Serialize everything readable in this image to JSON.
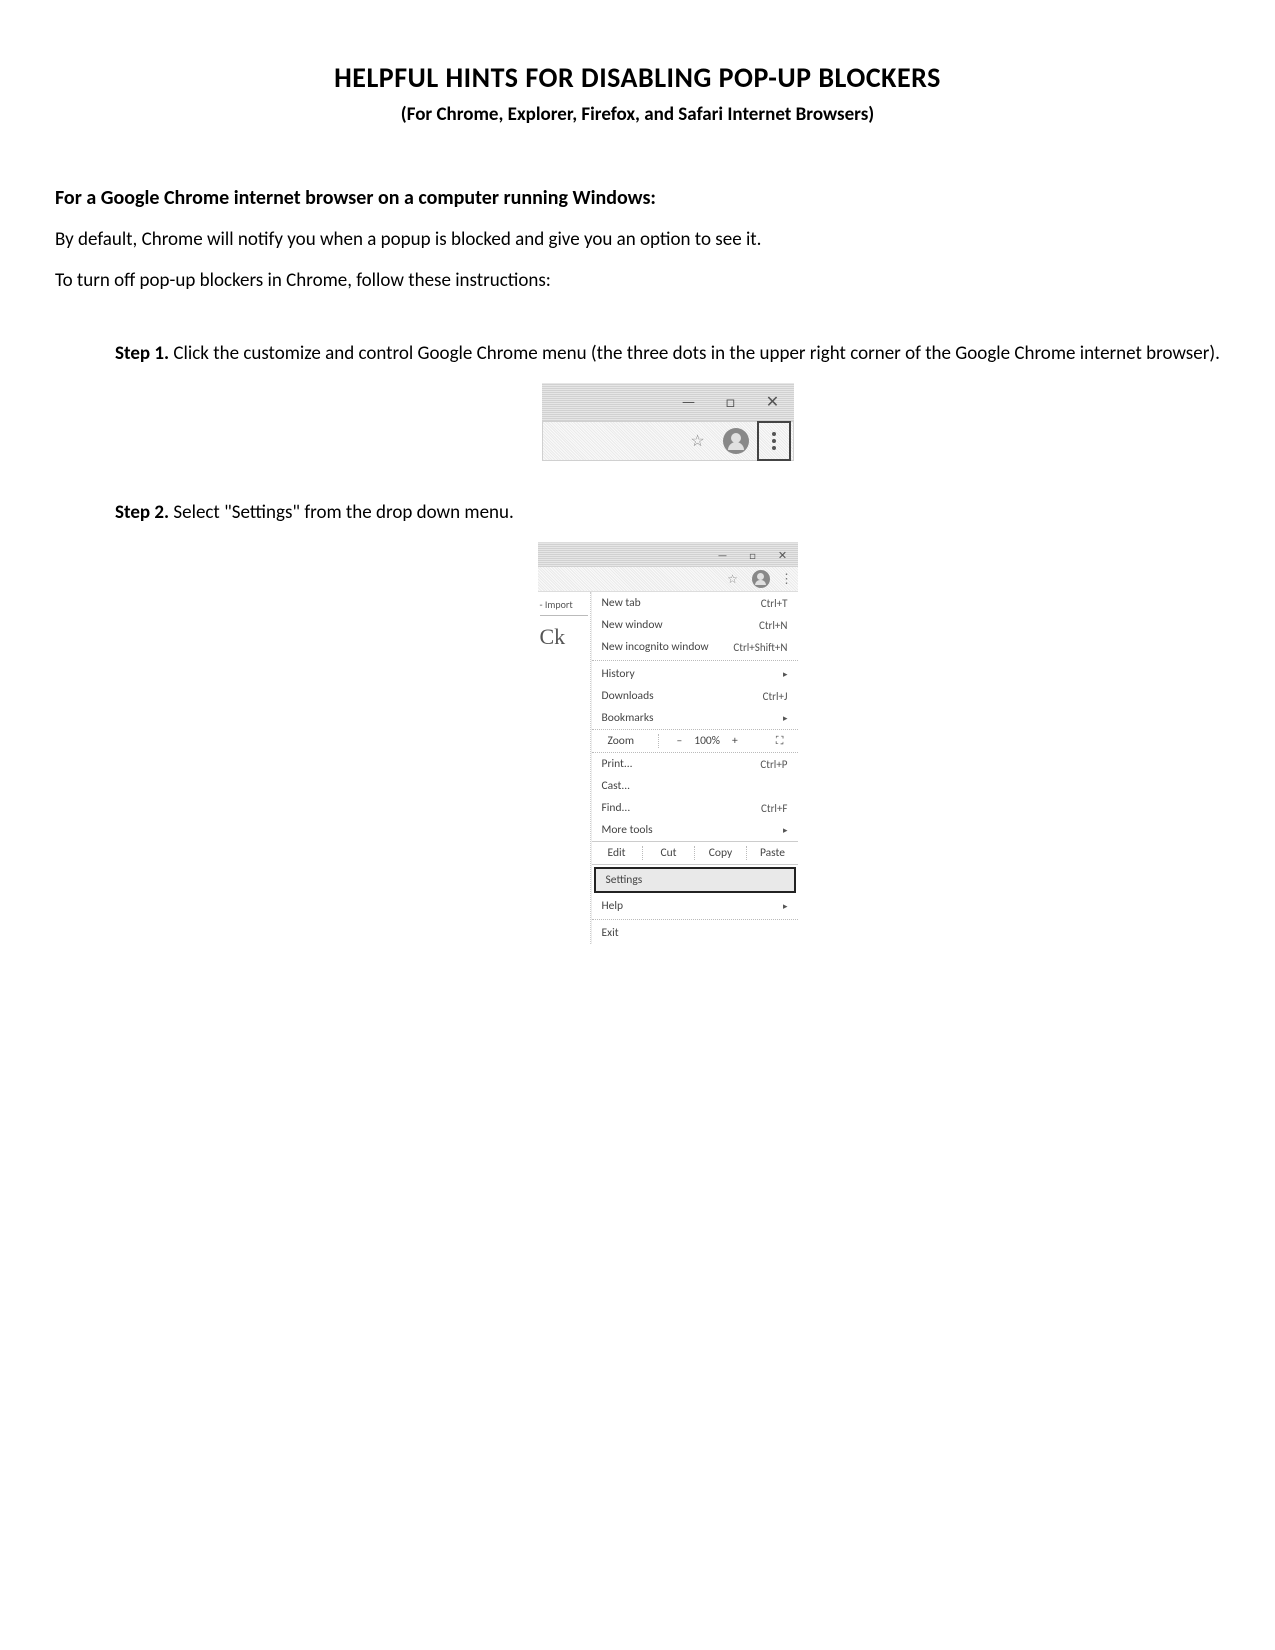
{
  "title": "HELPFUL HINTS FOR DISABLING POP-UP BLOCKERS",
  "subtitle": "(For Chrome, Explorer, Firefox, and Safari Internet Browsers)",
  "section_heading": "For a Google Chrome internet browser on a computer running Windows:",
  "para1": "By default, Chrome will notify you when a popup is blocked and give you an option to see it.",
  "para2": "To turn off pop-up blockers in Chrome, follow these instructions:",
  "step1_label": "Step 1.",
  "step1_text": "  Click the customize and control Google Chrome menu (the three dots in the upper right corner of the Google Chrome internet browser).",
  "step2_label": "Step 2.",
  "step2_text": "  Select \"Settings\" from the drop down menu.",
  "win": {
    "min": "—",
    "max": "□",
    "close": "✕"
  },
  "star": "☆",
  "fig2_left": {
    "import": "- Import",
    "ck": "Ck"
  },
  "menu": {
    "new_tab": {
      "label": "New tab",
      "shortcut": "Ctrl+T"
    },
    "new_window": {
      "label": "New window",
      "shortcut": "Ctrl+N"
    },
    "incognito": {
      "label": "New incognito window",
      "shortcut": "Ctrl+Shift+N"
    },
    "history": {
      "label": "History"
    },
    "downloads": {
      "label": "Downloads",
      "shortcut": "Ctrl+J"
    },
    "bookmarks": {
      "label": "Bookmarks"
    },
    "zoom": {
      "label": "Zoom",
      "minus": "–",
      "value": "100%",
      "plus": "+"
    },
    "print": {
      "label": "Print...",
      "shortcut": "Ctrl+P"
    },
    "cast": {
      "label": "Cast..."
    },
    "find": {
      "label": "Find...",
      "shortcut": "Ctrl+F"
    },
    "more": {
      "label": "More tools"
    },
    "edit": {
      "label": "Edit",
      "cut": "Cut",
      "copy": "Copy",
      "paste": "Paste"
    },
    "settings": {
      "label": "Settings"
    },
    "help": {
      "label": "Help"
    },
    "exit": {
      "label": "Exit"
    }
  },
  "arrow": "▸"
}
